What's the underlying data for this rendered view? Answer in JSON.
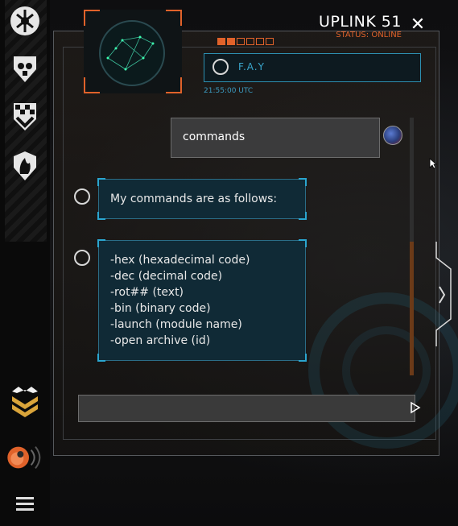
{
  "header": {
    "title": "UPLINK 51",
    "status": "STATUS: ONLINE",
    "close_label": "✕"
  },
  "contact": {
    "name": "F.A.Y",
    "timestamp": "21:55:00   UTC"
  },
  "messages": [
    {
      "sender": "user",
      "text": "commands"
    },
    {
      "sender": "bot",
      "text": "My commands are as follows:"
    },
    {
      "sender": "bot",
      "lines": [
        "-hex (hexadecimal code)",
        "-dec (decimal code)",
        "-rot## (text)",
        "-bin (binary code)",
        "-launch (module name)",
        "-open archive (id)"
      ]
    }
  ],
  "input": {
    "value": "",
    "placeholder": ""
  },
  "sidebar": {
    "icons": [
      "emblem-arrows-icon",
      "skull-shield-icon",
      "checkered-chevron-icon",
      "flame-shield-icon"
    ],
    "bottom_icons": [
      "rank-chevrons-icon",
      "uplink-orb-icon",
      "menu-icon"
    ]
  },
  "colors": {
    "accent": "#e0622a",
    "cyan": "#2aa6d0",
    "status": "#e0622a"
  }
}
